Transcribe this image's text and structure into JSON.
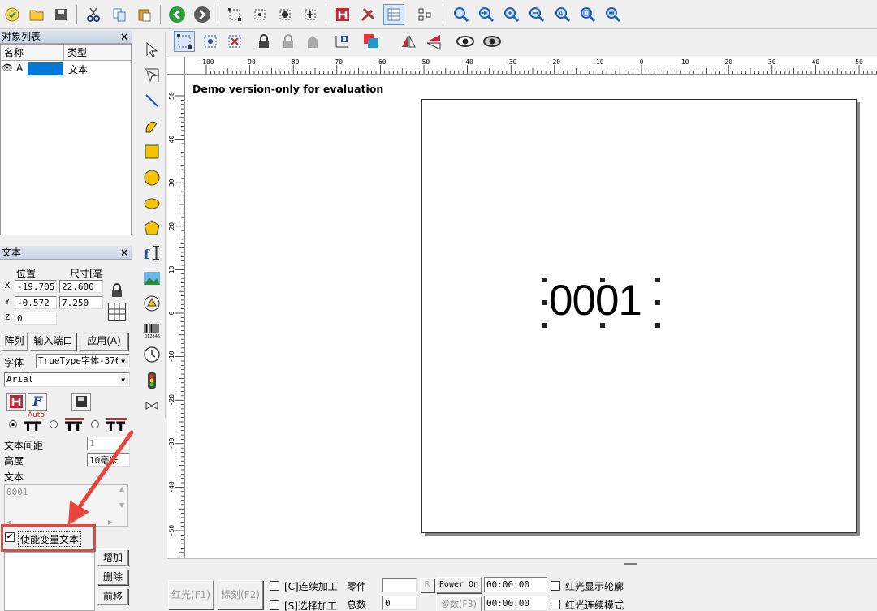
{
  "watermark": "Demo version-only for evaluation",
  "canvas_text": "0001",
  "object_list": {
    "title": "对象列表",
    "close": "×",
    "col_name": "名称",
    "col_type": "类型",
    "rows": [
      {
        "name": "A",
        "type": "文本"
      }
    ]
  },
  "text_panel": {
    "title": "文本",
    "close": "×",
    "pos_label": "位置",
    "size_label": "尺寸[毫",
    "x_label": "X",
    "y_label": "Y",
    "z_label": "Z",
    "x_pos": "-19.705",
    "x_size": "22.600",
    "y_pos": "-0.572",
    "y_size": "7.250",
    "z_pos": "0",
    "array_btn": "阵列",
    "input_port_btn": "输入端口",
    "apply_btn": "应用(A)",
    "font_label": "字体",
    "font_type": "TrueType字体-376",
    "font_name": "Arial",
    "bold_f": "F",
    "auto_label": "Auto",
    "tt": "TT",
    "spacing_label": "文本间距",
    "spacing_value": "1",
    "height_label": "高度",
    "height_value": "10毫米",
    "text_label": "文本",
    "text_value": "0001",
    "enable_variable": "使能变量文本",
    "add_btn": "增加",
    "delete_btn": "删除",
    "forward_btn": "前移"
  },
  "ruler": {
    "h_labels": [
      "-100",
      "-90",
      "-80",
      "-70",
      "-60",
      "-50",
      "-40",
      "-30",
      "-20",
      "-10",
      "0",
      "10",
      "20",
      "30",
      "40",
      "50"
    ],
    "v_labels": [
      "50",
      "40",
      "30",
      "20",
      "10",
      "0",
      "-10",
      "-20",
      "-30",
      "-40",
      "-50"
    ]
  },
  "bottom": {
    "red_light": "红光(F1)",
    "mark": "标刻(F2)",
    "continuous": "[C]连续加工",
    "select_process": "[S]选择加工",
    "part_label": "零件",
    "total_label": "总数",
    "total_value": "0",
    "r_btn": "R",
    "power_on": "Power On",
    "params": "参数(F3)",
    "time1": "00:00:00",
    "time2": "00:00:00",
    "show_outline": "红光显示轮廓",
    "continuous_red": "红光连续模式"
  },
  "colors": {
    "accent": "#0078d7",
    "red_arrow": "#e8453c",
    "toolbar_bg": "#f0f0f0"
  }
}
